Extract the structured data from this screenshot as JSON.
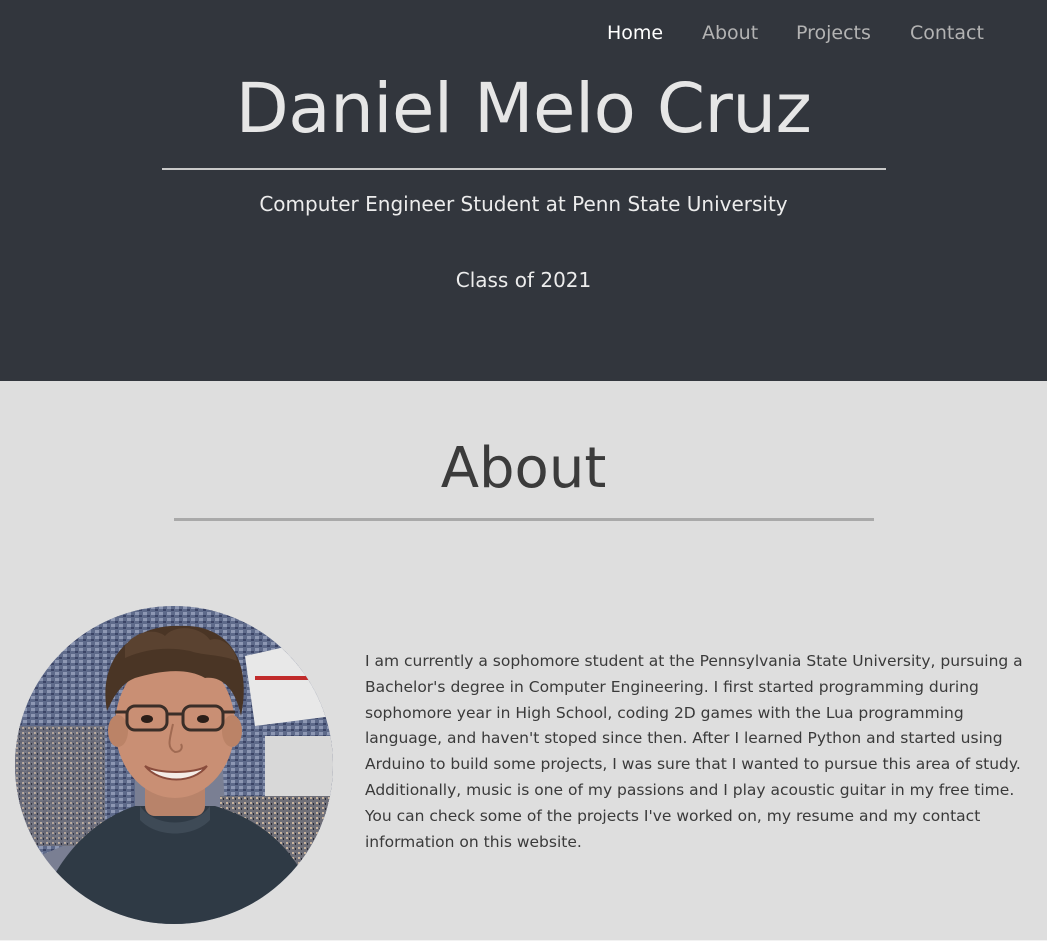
{
  "nav": {
    "items": [
      {
        "label": "Home",
        "active": true
      },
      {
        "label": "About",
        "active": false
      },
      {
        "label": "Projects",
        "active": false
      },
      {
        "label": "Contact",
        "active": false
      }
    ]
  },
  "header": {
    "name": "Daniel Melo Cruz",
    "subtitle": "Computer Engineer Student at Penn State University",
    "class_year": "Class of 2021"
  },
  "about": {
    "heading": "About",
    "bio": "I am currently a sophomore student at the Pennsylvania State University, pursuing a Bachelor's degree in Computer Engineering. I first started programming during sophomore year in High School, coding 2D games with the Lua programming language, and haven't stoped since then. After I learned Python and started using Arduino to build some projects, I was sure that I wanted to pursue this area of study. Additionally, music is one of my passions and I play acoustic guitar in my free time. You can check some of the projects I've worked on, my resume and my contact information on this website."
  },
  "colors": {
    "header_bg": "#32363d",
    "page_bg": "#dedede",
    "nav_active": "#ffffff",
    "nav_inactive": "#b3b3b3"
  }
}
